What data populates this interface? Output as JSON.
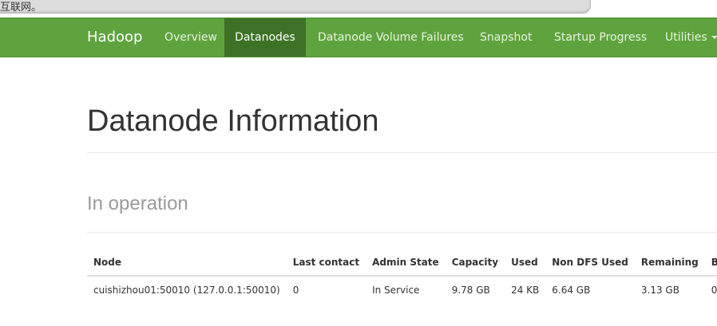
{
  "browser": {
    "notice_text": "互联网。"
  },
  "navbar": {
    "brand": "Hadoop",
    "items": [
      {
        "label": "Overview"
      },
      {
        "label": "Datanodes"
      },
      {
        "label": "Datanode Volume Failures"
      },
      {
        "label": "Snapshot"
      },
      {
        "label": "Startup Progress"
      },
      {
        "label": "Utilities"
      }
    ],
    "active_item": "Datanodes"
  },
  "page": {
    "title": "Datanode Information",
    "section_title": "In operation"
  },
  "table": {
    "columns": [
      "Node",
      "Last contact",
      "Admin State",
      "Capacity",
      "Used",
      "Non DFS Used",
      "Remaining",
      "B"
    ],
    "rows": [
      [
        "cuishizhou01:50010 (127.0.0.1:50010)",
        "0",
        "In Service",
        "9.78 GB",
        "24 KB",
        "6.64 GB",
        "3.13 GB",
        "0"
      ]
    ]
  },
  "colors": {
    "navbar_bg": "#5fa33e",
    "navbar_active_bg": "#3d7226",
    "title_text": "#333333",
    "section_text": "#9a9a9a"
  }
}
